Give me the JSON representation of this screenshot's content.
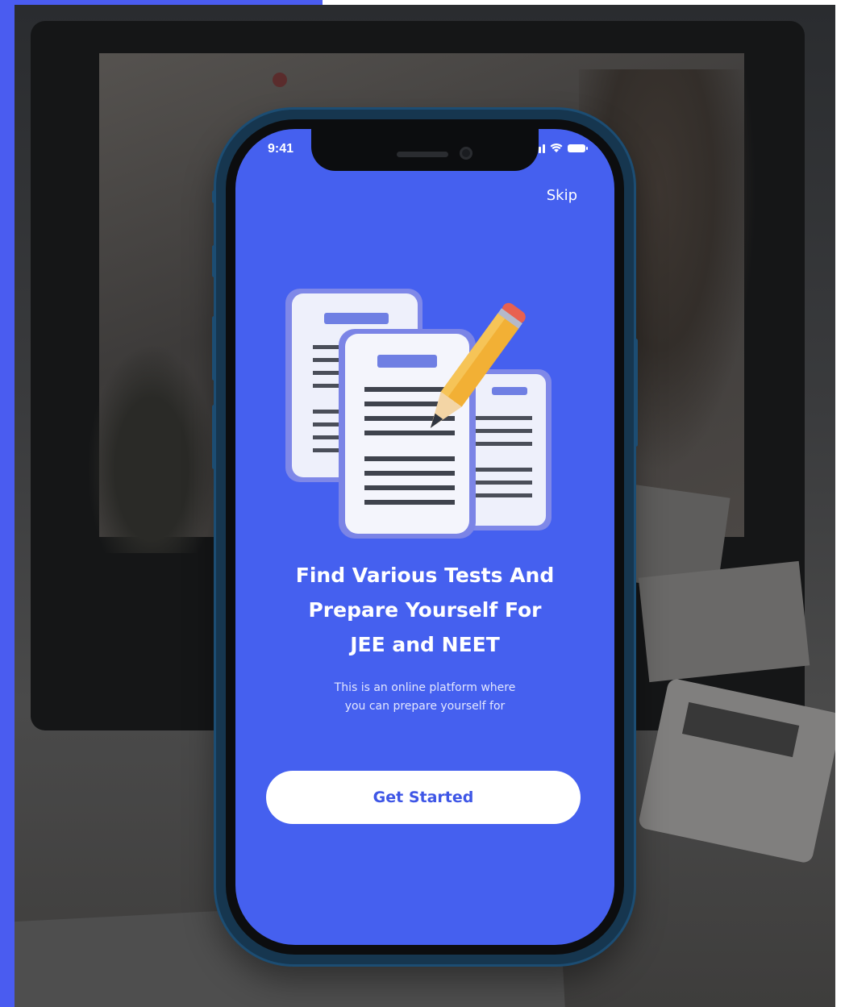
{
  "status_bar": {
    "time": "9:41",
    "signal_icon": "signal-bars-icon",
    "wifi_icon": "wifi-icon",
    "battery_icon": "battery-icon"
  },
  "onboarding": {
    "skip_label": "Skip",
    "illustration_icon": "test-papers-with-pencil-icon",
    "headline_lines": [
      "Find Various Tests And",
      "Prepare Yourself For",
      "JEE and NEET"
    ],
    "description_lines": [
      "This is an online platform where",
      "you can prepare yourself for"
    ],
    "cta_label": "Get Started"
  },
  "colors": {
    "accent": "#4560ef",
    "button_background": "#ffffff",
    "button_text": "#3e56e6",
    "text": "#ffffff"
  }
}
